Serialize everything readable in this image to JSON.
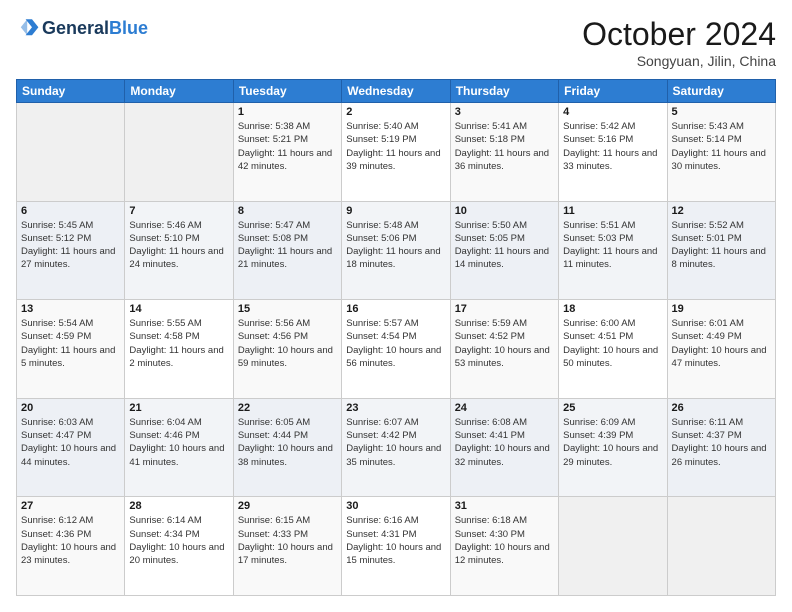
{
  "header": {
    "logo_general": "General",
    "logo_blue": "Blue",
    "month_title": "October 2024",
    "location": "Songyuan, Jilin, China"
  },
  "days_of_week": [
    "Sunday",
    "Monday",
    "Tuesday",
    "Wednesday",
    "Thursday",
    "Friday",
    "Saturday"
  ],
  "weeks": [
    [
      {
        "day": "",
        "info": ""
      },
      {
        "day": "",
        "info": ""
      },
      {
        "day": "1",
        "info": "Sunrise: 5:38 AM\nSunset: 5:21 PM\nDaylight: 11 hours and 42 minutes."
      },
      {
        "day": "2",
        "info": "Sunrise: 5:40 AM\nSunset: 5:19 PM\nDaylight: 11 hours and 39 minutes."
      },
      {
        "day": "3",
        "info": "Sunrise: 5:41 AM\nSunset: 5:18 PM\nDaylight: 11 hours and 36 minutes."
      },
      {
        "day": "4",
        "info": "Sunrise: 5:42 AM\nSunset: 5:16 PM\nDaylight: 11 hours and 33 minutes."
      },
      {
        "day": "5",
        "info": "Sunrise: 5:43 AM\nSunset: 5:14 PM\nDaylight: 11 hours and 30 minutes."
      }
    ],
    [
      {
        "day": "6",
        "info": "Sunrise: 5:45 AM\nSunset: 5:12 PM\nDaylight: 11 hours and 27 minutes."
      },
      {
        "day": "7",
        "info": "Sunrise: 5:46 AM\nSunset: 5:10 PM\nDaylight: 11 hours and 24 minutes."
      },
      {
        "day": "8",
        "info": "Sunrise: 5:47 AM\nSunset: 5:08 PM\nDaylight: 11 hours and 21 minutes."
      },
      {
        "day": "9",
        "info": "Sunrise: 5:48 AM\nSunset: 5:06 PM\nDaylight: 11 hours and 18 minutes."
      },
      {
        "day": "10",
        "info": "Sunrise: 5:50 AM\nSunset: 5:05 PM\nDaylight: 11 hours and 14 minutes."
      },
      {
        "day": "11",
        "info": "Sunrise: 5:51 AM\nSunset: 5:03 PM\nDaylight: 11 hours and 11 minutes."
      },
      {
        "day": "12",
        "info": "Sunrise: 5:52 AM\nSunset: 5:01 PM\nDaylight: 11 hours and 8 minutes."
      }
    ],
    [
      {
        "day": "13",
        "info": "Sunrise: 5:54 AM\nSunset: 4:59 PM\nDaylight: 11 hours and 5 minutes."
      },
      {
        "day": "14",
        "info": "Sunrise: 5:55 AM\nSunset: 4:58 PM\nDaylight: 11 hours and 2 minutes."
      },
      {
        "day": "15",
        "info": "Sunrise: 5:56 AM\nSunset: 4:56 PM\nDaylight: 10 hours and 59 minutes."
      },
      {
        "day": "16",
        "info": "Sunrise: 5:57 AM\nSunset: 4:54 PM\nDaylight: 10 hours and 56 minutes."
      },
      {
        "day": "17",
        "info": "Sunrise: 5:59 AM\nSunset: 4:52 PM\nDaylight: 10 hours and 53 minutes."
      },
      {
        "day": "18",
        "info": "Sunrise: 6:00 AM\nSunset: 4:51 PM\nDaylight: 10 hours and 50 minutes."
      },
      {
        "day": "19",
        "info": "Sunrise: 6:01 AM\nSunset: 4:49 PM\nDaylight: 10 hours and 47 minutes."
      }
    ],
    [
      {
        "day": "20",
        "info": "Sunrise: 6:03 AM\nSunset: 4:47 PM\nDaylight: 10 hours and 44 minutes."
      },
      {
        "day": "21",
        "info": "Sunrise: 6:04 AM\nSunset: 4:46 PM\nDaylight: 10 hours and 41 minutes."
      },
      {
        "day": "22",
        "info": "Sunrise: 6:05 AM\nSunset: 4:44 PM\nDaylight: 10 hours and 38 minutes."
      },
      {
        "day": "23",
        "info": "Sunrise: 6:07 AM\nSunset: 4:42 PM\nDaylight: 10 hours and 35 minutes."
      },
      {
        "day": "24",
        "info": "Sunrise: 6:08 AM\nSunset: 4:41 PM\nDaylight: 10 hours and 32 minutes."
      },
      {
        "day": "25",
        "info": "Sunrise: 6:09 AM\nSunset: 4:39 PM\nDaylight: 10 hours and 29 minutes."
      },
      {
        "day": "26",
        "info": "Sunrise: 6:11 AM\nSunset: 4:37 PM\nDaylight: 10 hours and 26 minutes."
      }
    ],
    [
      {
        "day": "27",
        "info": "Sunrise: 6:12 AM\nSunset: 4:36 PM\nDaylight: 10 hours and 23 minutes."
      },
      {
        "day": "28",
        "info": "Sunrise: 6:14 AM\nSunset: 4:34 PM\nDaylight: 10 hours and 20 minutes."
      },
      {
        "day": "29",
        "info": "Sunrise: 6:15 AM\nSunset: 4:33 PM\nDaylight: 10 hours and 17 minutes."
      },
      {
        "day": "30",
        "info": "Sunrise: 6:16 AM\nSunset: 4:31 PM\nDaylight: 10 hours and 15 minutes."
      },
      {
        "day": "31",
        "info": "Sunrise: 6:18 AM\nSunset: 4:30 PM\nDaylight: 10 hours and 12 minutes."
      },
      {
        "day": "",
        "info": ""
      },
      {
        "day": "",
        "info": ""
      }
    ]
  ]
}
